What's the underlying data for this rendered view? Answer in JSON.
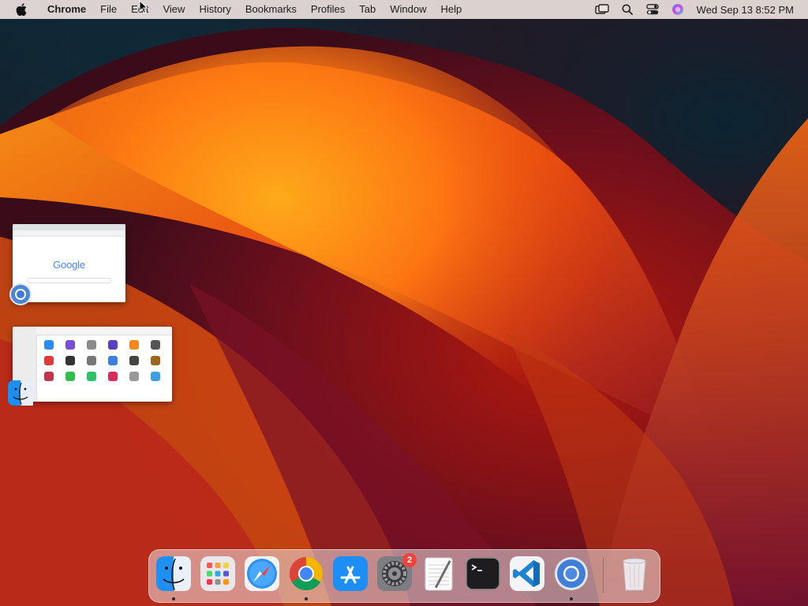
{
  "menubar": {
    "app_name": "Chrome",
    "items": [
      "File",
      "Edit",
      "View",
      "History",
      "Bookmarks",
      "Profiles",
      "Tab",
      "Window",
      "Help"
    ],
    "clock": "Wed Sep 13  8:52 PM",
    "status_icons": [
      "screen-mirroring-icon",
      "spotlight-search-icon",
      "control-center-icon",
      "siri-icon"
    ]
  },
  "desktop": {
    "thumbnails": [
      {
        "app": "Google Chrome",
        "content_logo": "Google"
      },
      {
        "app": "Finder"
      }
    ]
  },
  "dock": {
    "items": [
      {
        "name": "Finder",
        "icon": "finder-icon",
        "running": true
      },
      {
        "name": "Launchpad",
        "icon": "launchpad-icon",
        "running": false
      },
      {
        "name": "Safari",
        "icon": "safari-icon",
        "running": false
      },
      {
        "name": "Google Chrome",
        "icon": "chrome-icon",
        "running": true
      },
      {
        "name": "App Store",
        "icon": "app-store-icon",
        "running": false
      },
      {
        "name": "System Settings",
        "icon": "system-settings-icon",
        "running": false,
        "badge": "2"
      },
      {
        "name": "TextEdit",
        "icon": "textedit-icon",
        "running": false
      },
      {
        "name": "Terminal",
        "icon": "terminal-icon",
        "running": false
      },
      {
        "name": "Visual Studio Code",
        "icon": "vscode-icon",
        "running": false
      },
      {
        "name": "Chromium",
        "icon": "chromium-icon",
        "running": true
      },
      {
        "name": "Trash",
        "icon": "trash-icon",
        "running": false
      }
    ]
  },
  "colors": {
    "menubar_bg": "#ece2de",
    "badge_red": "#f2433b"
  }
}
